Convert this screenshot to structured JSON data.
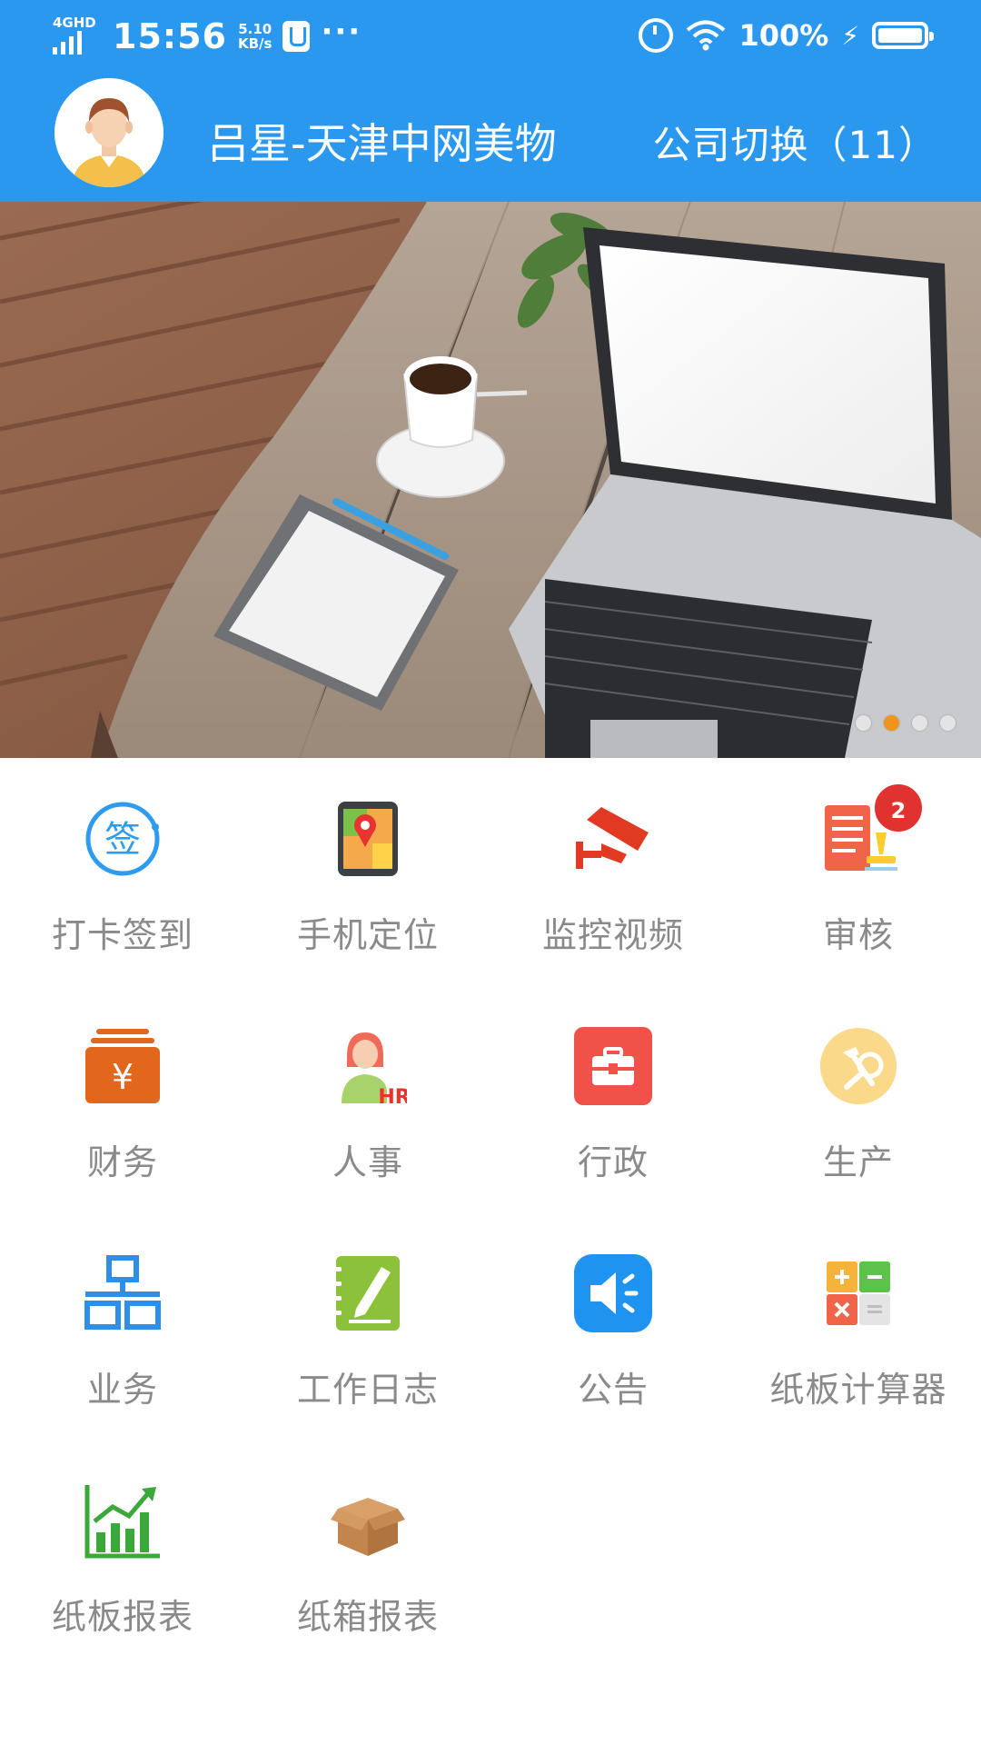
{
  "status_bar": {
    "network": "4GHD",
    "time": "15:56",
    "speed_value": "5.10",
    "speed_unit": "KB/s",
    "more": "···",
    "battery_pct": "100%"
  },
  "header": {
    "user_name": "吕星-天津中网美物",
    "switch_label": "公司切换（11）",
    "bg_color": "#2b98f0"
  },
  "banner": {
    "slide_count": 4,
    "active_slide": 2
  },
  "menu": [
    {
      "label": "打卡签到",
      "icon": "check-in-icon",
      "glyph": "签"
    },
    {
      "label": "手机定位",
      "icon": "phone-location-icon"
    },
    {
      "label": "监控视频",
      "icon": "surveillance-camera-icon"
    },
    {
      "label": "审核",
      "icon": "review-icon",
      "badge": "2"
    },
    {
      "label": "财务",
      "icon": "finance-icon",
      "glyph": "¥"
    },
    {
      "label": "人事",
      "icon": "hr-icon",
      "glyph": "HR"
    },
    {
      "label": "行政",
      "icon": "admin-toolbox-icon"
    },
    {
      "label": "生产",
      "icon": "production-tools-icon"
    },
    {
      "label": "业务",
      "icon": "business-org-icon"
    },
    {
      "label": "工作日志",
      "icon": "work-log-icon"
    },
    {
      "label": "公告",
      "icon": "announcement-speaker-icon"
    },
    {
      "label": "纸板计算器",
      "icon": "calculator-icon"
    },
    {
      "label": "纸板报表",
      "icon": "board-report-chart-icon"
    },
    {
      "label": "纸箱报表",
      "icon": "carton-box-icon"
    }
  ]
}
